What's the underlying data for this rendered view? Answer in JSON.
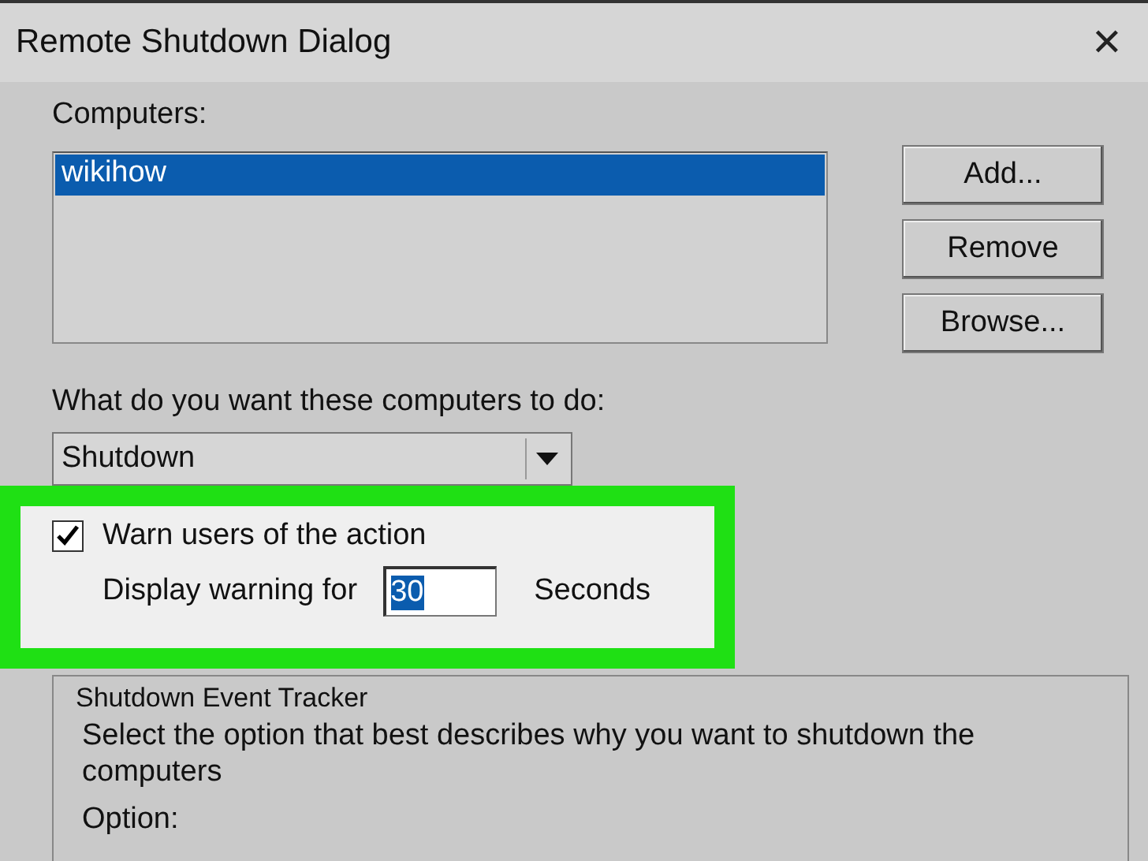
{
  "window": {
    "title": "Remote Shutdown Dialog",
    "close": "✕"
  },
  "computers": {
    "label": "Computers:",
    "items": [
      {
        "name": "wikihow",
        "selected": true
      }
    ]
  },
  "buttons": [
    "Add...",
    "Remove",
    "Browse..."
  ],
  "action": {
    "label": "What do you want these computers to do:",
    "value": "Shutdown"
  },
  "warn": {
    "label": "Warn users of the action",
    "checked": true,
    "display_label": "Display warning for",
    "seconds_value": "30",
    "seconds_label": "Seconds"
  },
  "tracker": {
    "title": "Shutdown Event Tracker",
    "description": "Select the option that best describes why you want to shutdown the computers",
    "option_label": "Option:"
  }
}
